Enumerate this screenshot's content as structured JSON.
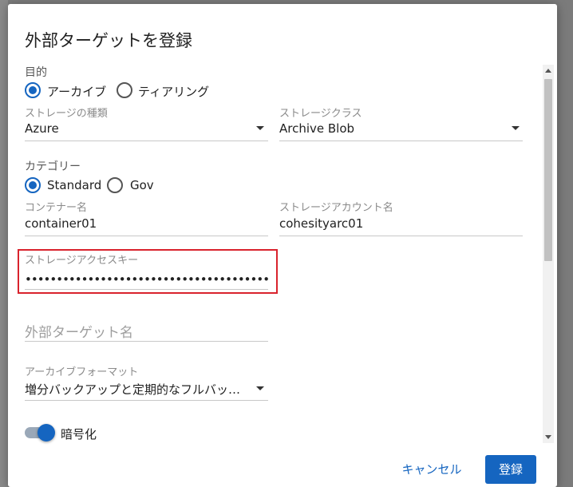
{
  "dialog": {
    "title": "外部ターゲットを登録"
  },
  "purpose": {
    "label": "目的",
    "options": [
      "アーカイブ",
      "ティアリング"
    ],
    "selected": "アーカイブ"
  },
  "storage_type": {
    "label": "ストレージの種類",
    "value": "Azure"
  },
  "storage_class": {
    "label": "ストレージクラス",
    "value": "Archive Blob"
  },
  "category": {
    "label": "カテゴリー",
    "options": [
      "Standard",
      "Gov"
    ],
    "selected": "Standard"
  },
  "container_name": {
    "label": "コンテナー名",
    "value": "container01"
  },
  "storage_account": {
    "label": "ストレージアカウント名",
    "value": "cohesityarc01"
  },
  "access_key": {
    "label": "ストレージアクセスキー",
    "masked_value": "••••••••••••••••••••••••••••••••••••••••••••••••••••••••••••••••"
  },
  "external_target_name": {
    "placeholder": "外部ターゲット名"
  },
  "archive_format": {
    "label": "アーカイブフォーマット",
    "value": "増分バックアップと定期的なフルバッ…"
  },
  "encryption": {
    "label": "暗号化",
    "enabled": true
  },
  "actions": {
    "cancel": "キャンセル",
    "register": "登録"
  },
  "colors": {
    "accent": "#1565c0",
    "highlight": "#d9232d"
  }
}
